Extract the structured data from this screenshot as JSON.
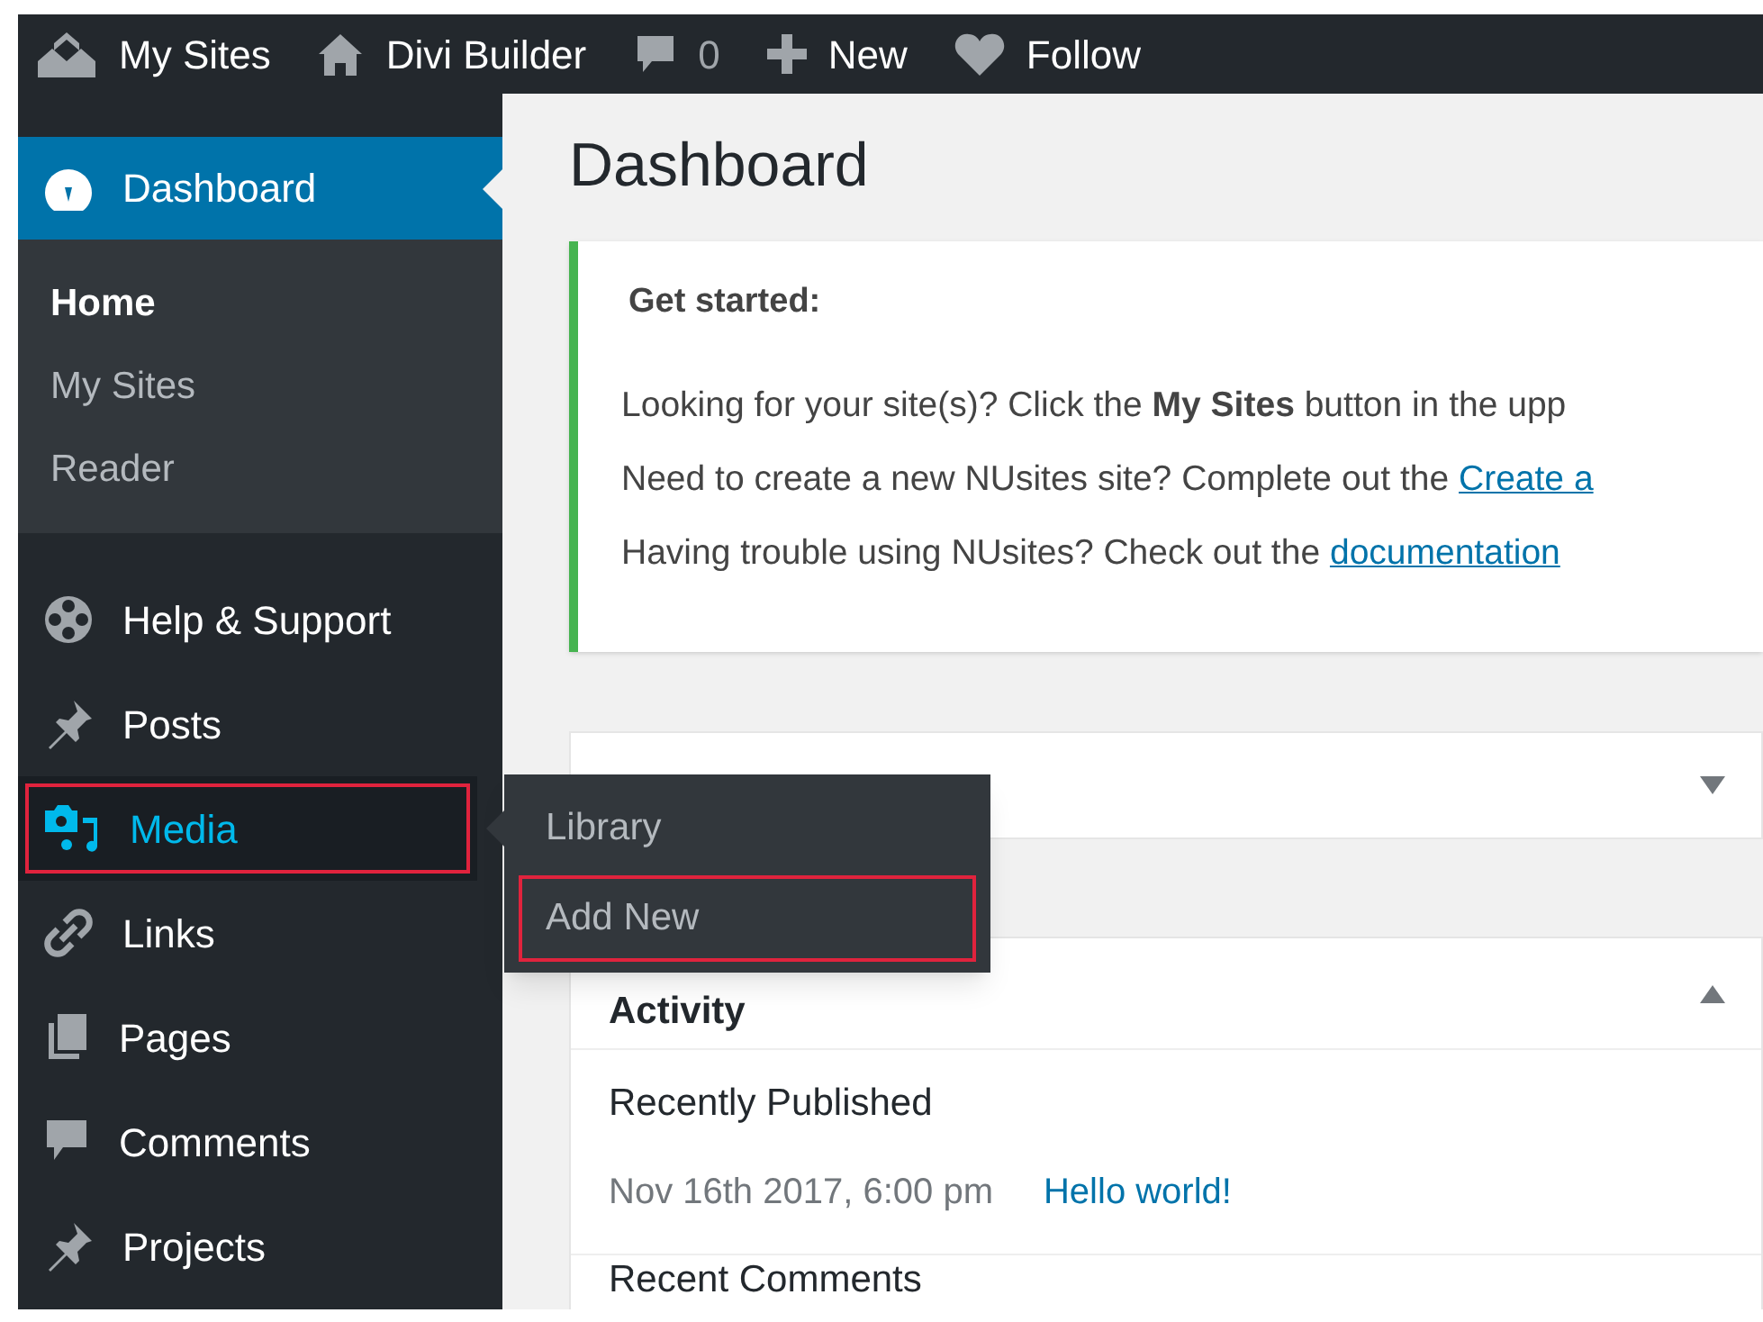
{
  "admin_bar": {
    "items": [
      {
        "label": "My Sites"
      },
      {
        "label": "Divi Builder"
      },
      {
        "label": "0"
      },
      {
        "label": "New"
      },
      {
        "label": "Follow"
      }
    ]
  },
  "sidebar": {
    "active": {
      "label": "Dashboard",
      "selected": true
    },
    "submenu": [
      {
        "label": "Home",
        "selected": true
      },
      {
        "label": "My Sites",
        "selected": false
      },
      {
        "label": "Reader",
        "selected": false
      }
    ],
    "items": [
      {
        "label": "Help & Support",
        "selected": false,
        "annotated": false
      },
      {
        "label": "Posts",
        "selected": false,
        "annotated": false
      },
      {
        "label": "Media",
        "selected": true,
        "annotated": true
      },
      {
        "label": "Links",
        "selected": false,
        "annotated": false
      },
      {
        "label": "Pages",
        "selected": false,
        "annotated": false
      },
      {
        "label": "Comments",
        "selected": false,
        "annotated": false
      },
      {
        "label": "Projects",
        "selected": false,
        "annotated": false
      }
    ]
  },
  "flyout": {
    "items": [
      {
        "label": "Library",
        "annotated": false
      },
      {
        "label": "Add New",
        "annotated": true
      }
    ]
  },
  "main": {
    "title": "Dashboard",
    "notice": {
      "heading": "Get started:",
      "lines": [
        {
          "text": "Looking for your site(s)? Click the **My Sites** button in the upp"
        },
        {
          "text": "Need to create a new NUsites site? Complete out the ",
          "link": "Create a"
        },
        {
          "text": "Having trouble using NUsites? Check out the ",
          "link": "documentation"
        }
      ]
    },
    "collapsed_box": {
      "expanded": false
    },
    "activity": {
      "title": "Activity",
      "expanded": true,
      "section": "Recently Published",
      "date": "Nov 16th 2017, 6:00 pm",
      "post": "Hello world!",
      "next_section": "Recent Comments"
    }
  }
}
